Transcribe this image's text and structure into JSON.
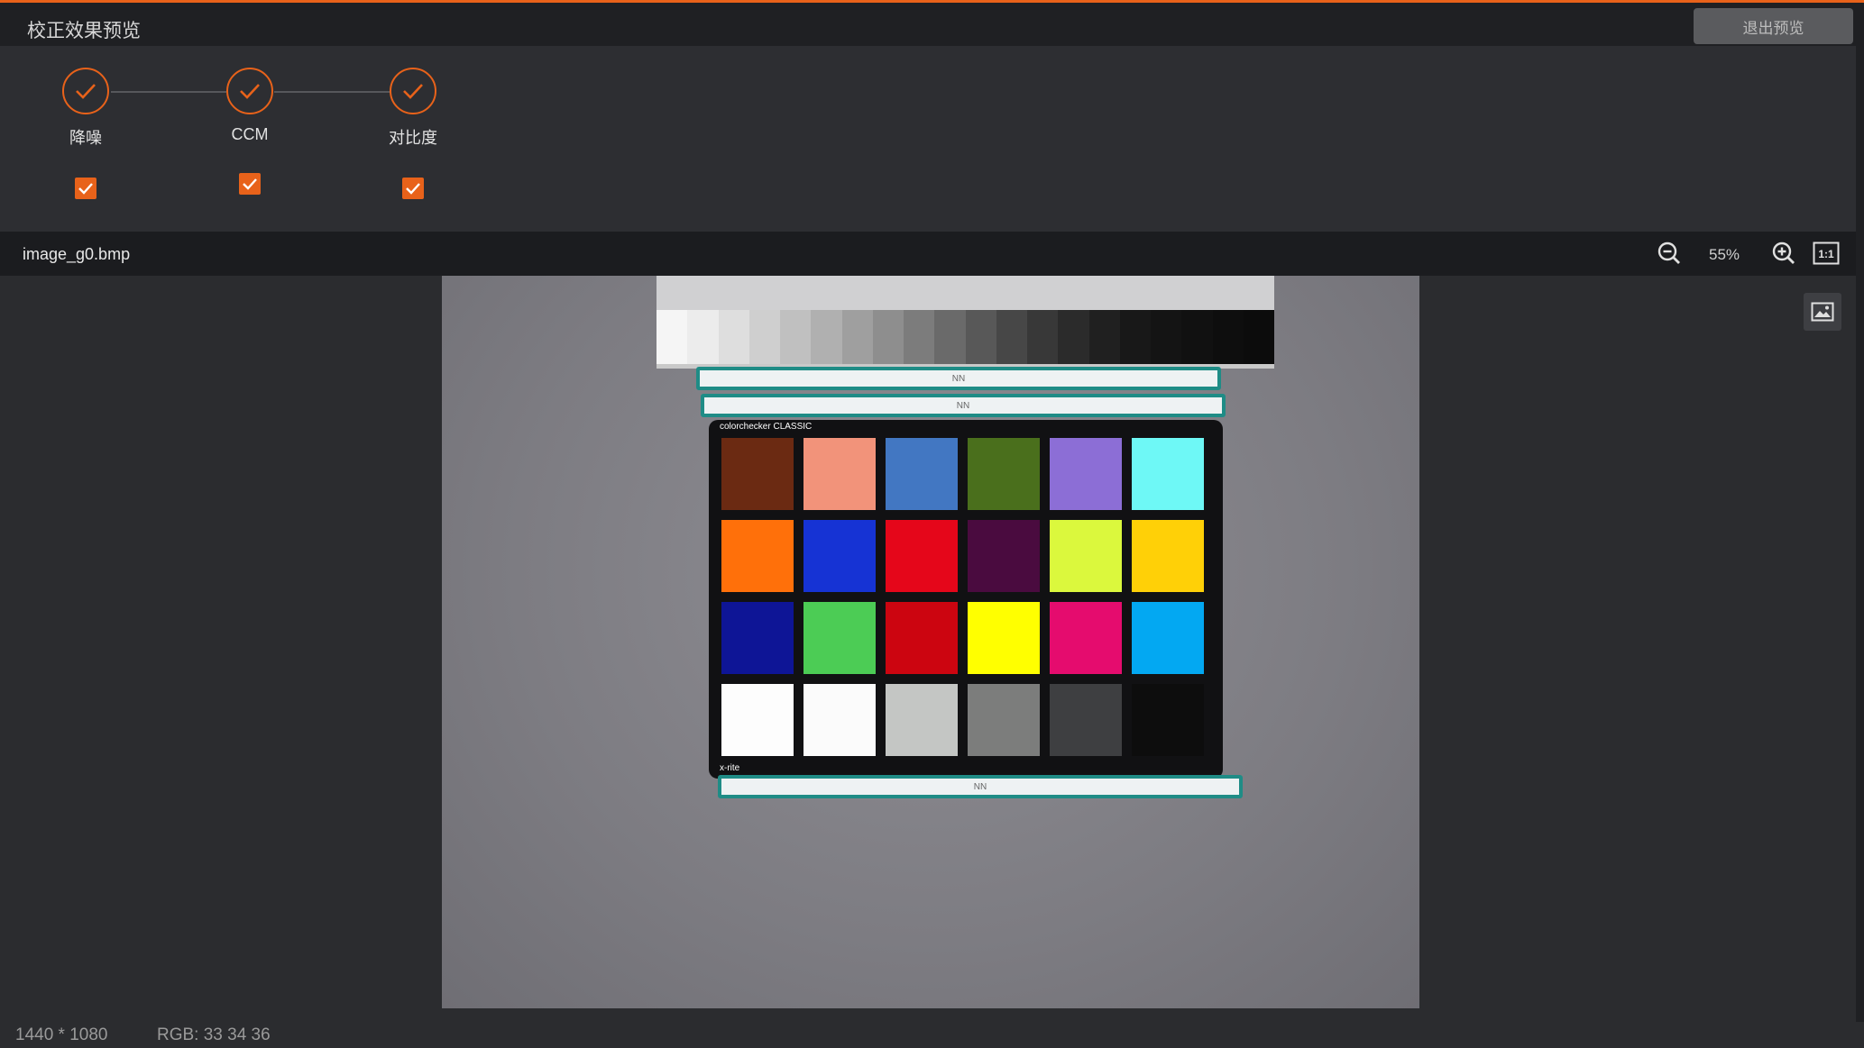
{
  "window": {
    "title": "校正效果预览",
    "exit_button": "退出预览"
  },
  "steps": [
    {
      "label": "降噪",
      "checked": true
    },
    {
      "label": "CCM",
      "checked": true
    },
    {
      "label": "对比度",
      "checked": true
    }
  ],
  "colors": {
    "accent": "#e8621a",
    "background": "#2b2c2f",
    "titlebar": "#1f2023"
  },
  "toolbar": {
    "filename": "image_g0.bmp",
    "zoom": "55%",
    "zoom_out_icon": "zoom-out-icon",
    "zoom_in_icon": "zoom-in-icon",
    "fit_icon": "actual-size-icon",
    "fit_label": "1:1"
  },
  "preview": {
    "nn_label": "NN",
    "card_brand": "colorchecker CLASSIC",
    "card_footer": "x-rite",
    "gray_steps": [
      "#f5f5f5",
      "#ececec",
      "#dedede",
      "#cfcfcf",
      "#c0c0c0",
      "#b0b0b0",
      "#9f9f9f",
      "#8e8e8e",
      "#7c7c7c",
      "#6a6a6a",
      "#585858",
      "#474747",
      "#383838",
      "#2b2b2b",
      "#202020",
      "#181818",
      "#141414",
      "#111111",
      "#0e0e0e",
      "#0c0c0c"
    ],
    "patches": [
      "#6b2a12",
      "#f2937a",
      "#4277c2",
      "#4a6f1c",
      "#8c6ed6",
      "#6ef8f6",
      "#ff700a",
      "#1633d4",
      "#e5061a",
      "#4a0b3f",
      "#dbf83d",
      "#ffd007",
      "#0e1596",
      "#4ccc55",
      "#cc0510",
      "#ffff00",
      "#e50c6e",
      "#03a8f2",
      "#fdfdfd",
      "#fbfbfb",
      "#c4c6c4",
      "#7c7d7c",
      "#3e3f41",
      "#0d0d0d"
    ]
  },
  "status": {
    "image_size": "1440 * 1080",
    "rgb": "RGB: 33 34 36"
  }
}
